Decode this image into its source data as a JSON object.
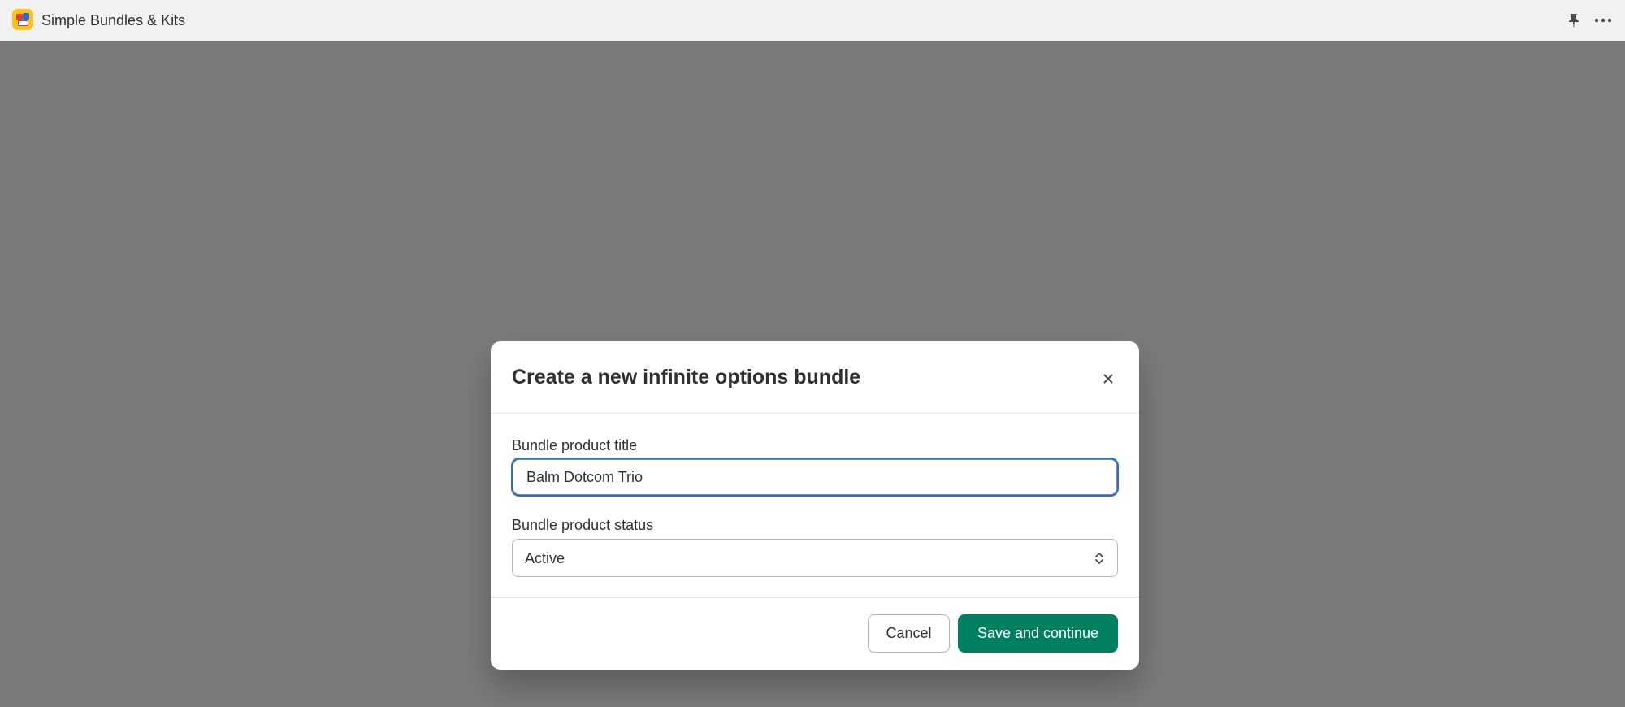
{
  "app": {
    "title": "Simple Bundles & Kits",
    "logo_icon": "app-logo-icon"
  },
  "topbar": {
    "pin_icon": "pin-icon",
    "more_icon": "more-icon"
  },
  "modal": {
    "title": "Create a new infinite options bundle",
    "close_icon": "close-icon",
    "title_field": {
      "label": "Bundle product title",
      "value": "Balm Dotcom Trio"
    },
    "status_field": {
      "label": "Bundle product status",
      "value": "Active",
      "icon": "select-arrows-icon"
    },
    "footer": {
      "cancel_label": "Cancel",
      "save_label": "Save and continue"
    }
  },
  "colors": {
    "primary": "#008060",
    "focus": "#2c6ecb",
    "backdrop": "#7a7b7d",
    "topbar": "#f1f1f1"
  }
}
